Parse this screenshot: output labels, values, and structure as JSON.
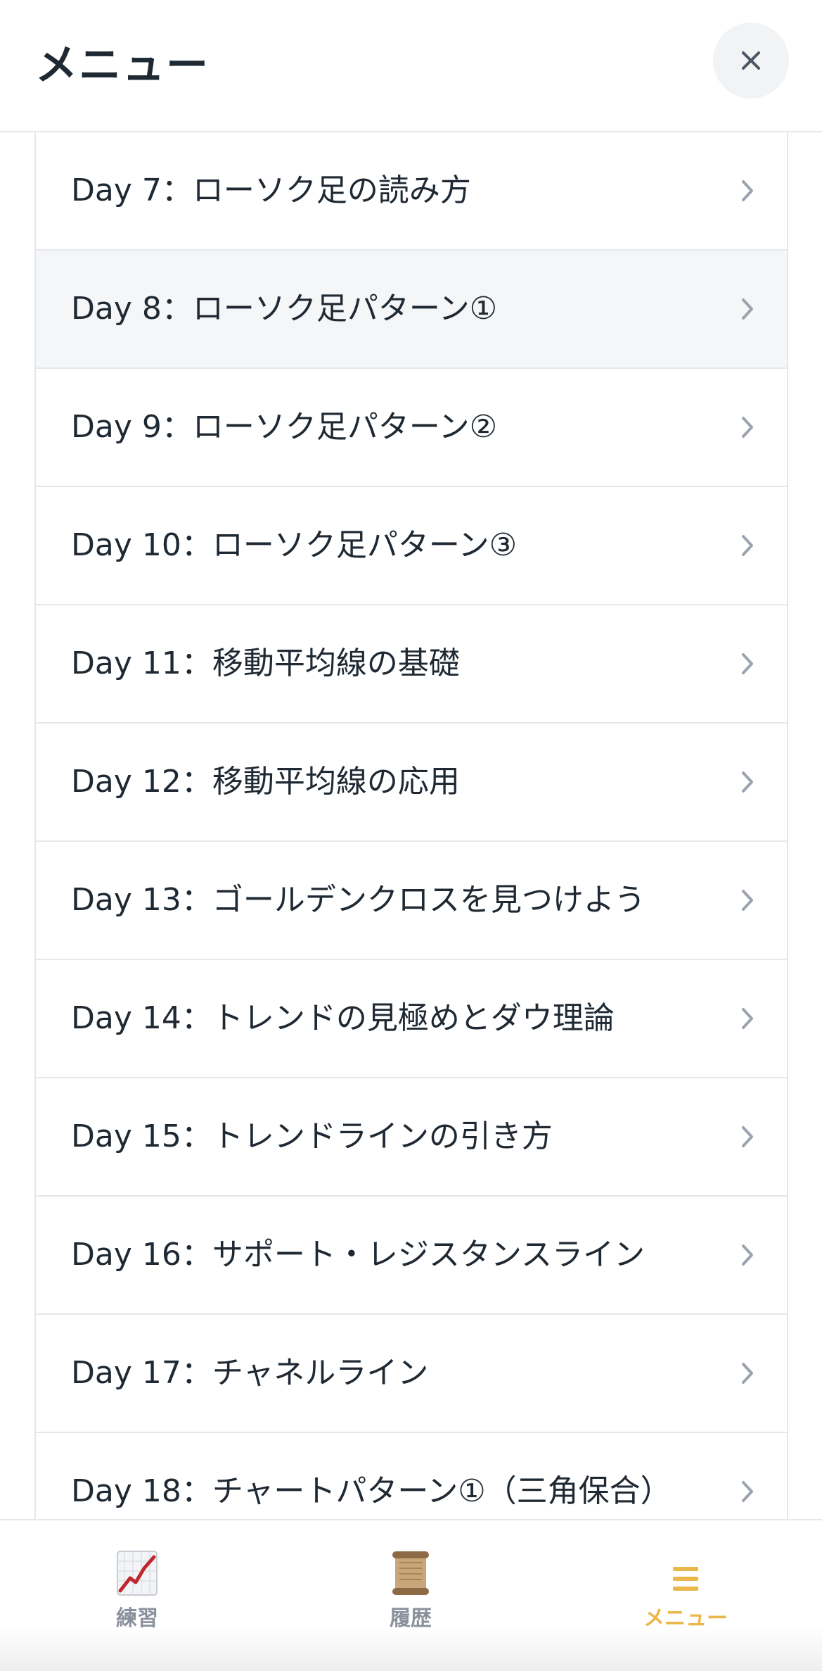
{
  "header": {
    "title": "メニュー"
  },
  "list": {
    "items": [
      {
        "label": "Day 7：ローソク足の読み方"
      },
      {
        "label": "Day 8：ローソク足パターン①"
      },
      {
        "label": "Day 9：ローソク足パターン②"
      },
      {
        "label": "Day 10：ローソク足パターン③"
      },
      {
        "label": "Day 11：移動平均線の基礎"
      },
      {
        "label": "Day 12：移動平均線の応用"
      },
      {
        "label": "Day 13：ゴールデンクロスを見つけよう"
      },
      {
        "label": "Day 14：トレンドの見極めとダウ理論"
      },
      {
        "label": "Day 15：トレンドラインの引き方"
      },
      {
        "label": "Day 16：サポート・レジスタンスライン"
      },
      {
        "label": "Day 17：チャネルライン"
      },
      {
        "label": "Day 18：チャートパターン①（三角保合）"
      }
    ],
    "highlighted_index": 1
  },
  "tabbar": {
    "tabs": [
      {
        "label": "練習",
        "icon": "chart-icon",
        "active": false
      },
      {
        "label": "履歴",
        "icon": "scroll-icon",
        "active": false
      },
      {
        "label": "メニュー",
        "icon": "hamburger-icon",
        "active": true
      }
    ]
  },
  "colors": {
    "accent": "#eab84a",
    "text": "#1f2933",
    "muted": "#8a919c",
    "divider": "#e5e7eb"
  }
}
